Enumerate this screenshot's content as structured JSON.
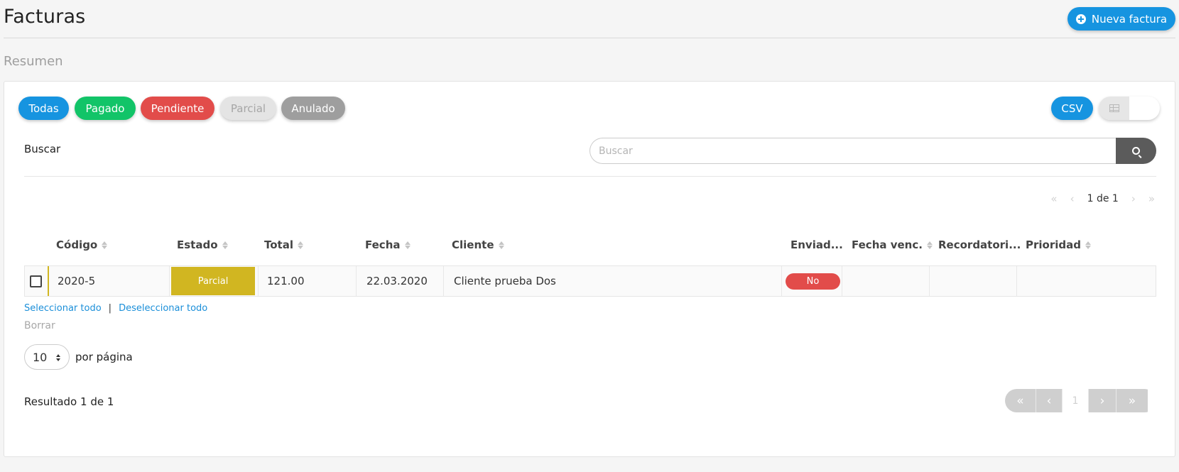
{
  "header": {
    "title": "Facturas",
    "new_button_label": "Nueva factura",
    "section_title": "Resumen"
  },
  "filters": [
    {
      "label": "Todas",
      "color": "#1694e0"
    },
    {
      "label": "Pagado",
      "color": "#12c468"
    },
    {
      "label": "Pendiente",
      "color": "#e24c4a"
    },
    {
      "label": "Parcial",
      "color": "#e4e4e4"
    },
    {
      "label": "Anulado",
      "color": "#9e9e9e"
    }
  ],
  "toolbar": {
    "csv_label": "CSV",
    "view_modes": [
      "table-view-icon",
      "card-view-icon"
    ]
  },
  "search": {
    "label": "Buscar",
    "placeholder": "Buscar",
    "value": ""
  },
  "pager_top": {
    "text": "1 de 1"
  },
  "table": {
    "columns": [
      "Código",
      "Estado",
      "Total",
      "Fecha",
      "Cliente",
      "Enviad...",
      "Fecha venc.",
      "Recordatori...",
      "Prioridad"
    ],
    "rows": [
      {
        "code": "2020-5",
        "status": "Parcial",
        "status_color": "#d1b621",
        "total": "121.00",
        "date": "22.03.2020",
        "client": "Cliente prueba Dos",
        "sent": "No",
        "due_date": "",
        "reminder": "",
        "priority": ""
      }
    ]
  },
  "selection": {
    "select_all": "Seleccionar todo",
    "separator": "|",
    "deselect_all": "Deseleccionar todo",
    "delete": "Borrar"
  },
  "per_page": {
    "value": "10",
    "label": "por página"
  },
  "footer": {
    "result_text": "Resultado 1 de 1",
    "current_page": "1"
  }
}
